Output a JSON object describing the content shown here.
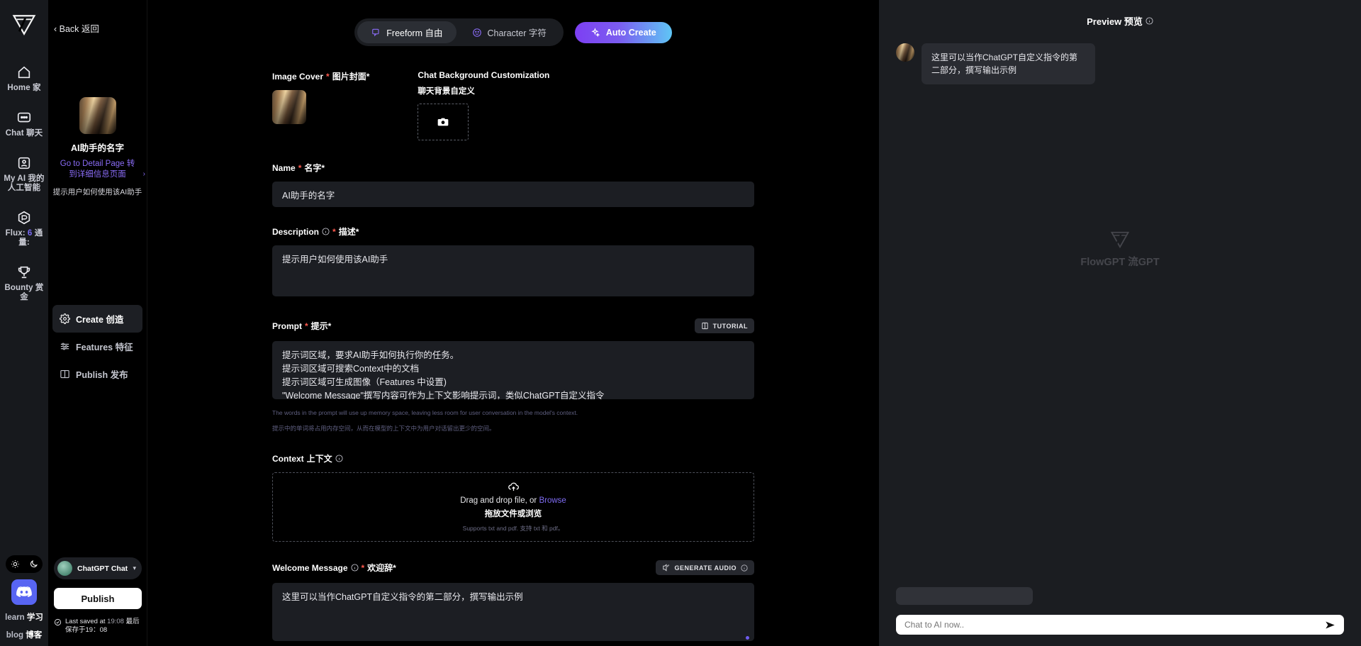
{
  "rail": {
    "logo_icon": "flowgpt-logo-icon",
    "items": [
      {
        "icon": "home-icon",
        "label": "Home 家"
      },
      {
        "icon": "chat-icon",
        "label": "Chat 聊天"
      },
      {
        "icon": "my-ai-icon",
        "label": "My AI 我的人工智能"
      },
      {
        "icon": "flux-icon",
        "label_pre": "Flux: ",
        "label_num": "6",
        "label_post": " 通量:"
      },
      {
        "icon": "trophy-icon",
        "label": "Bounty 赏金"
      }
    ],
    "theme": {
      "light_icon": "sun-icon",
      "dark_icon": "moon-icon"
    },
    "discord_icon": "discord-icon",
    "links": [
      {
        "en": "learn ",
        "zh": "学习"
      },
      {
        "en": "blog ",
        "zh": "博客"
      }
    ]
  },
  "side": {
    "back_label": "‹ Back 返回",
    "bot_name": "AI助手的名字",
    "detail_link": "Go to Detail Page 转到详细信息页面",
    "bot_desc": "提示用户如何使用该AI助手",
    "menu": [
      {
        "icon": "gear-icon",
        "label": "Create 创造",
        "active": true
      },
      {
        "icon": "sliders-icon",
        "label": "Features 特征",
        "active": false
      },
      {
        "icon": "book-icon",
        "label": "Publish 发布",
        "active": false
      }
    ],
    "account_name": "ChatGPT ChatGPT的",
    "publish_label": "Publish",
    "saved_prefix": "Last saved at ",
    "saved_time": "19:08",
    "saved_suffix": " 最后保存于19：08"
  },
  "main": {
    "tabs": [
      {
        "icon": "speech-bubble-icon",
        "label": "Freeform  自由",
        "active": true
      },
      {
        "icon": "smiley-icon",
        "label": "Character  字符",
        "active": false
      }
    ],
    "auto_create": {
      "icon": "sparkle-icon",
      "label": "Auto Create"
    },
    "image_cover": {
      "label_en": "Image Cover",
      "req": "*",
      "label_zh": " 图片封面*"
    },
    "chat_bg": {
      "label_en": "Chat Background Customization",
      "label_zh": "聊天背景自定义",
      "upload_icon": "camera-icon"
    },
    "name": {
      "label_en": "Name",
      "req": "*",
      "label_zh": " 名字*",
      "value": "AI助手的名字"
    },
    "description": {
      "label_en": "Description",
      "info_icon": "info-icon",
      "req": "*",
      "label_zh": " 描述*",
      "value": "提示用户如何使用该AI助手"
    },
    "prompt": {
      "label_en": "Prompt",
      "req": "*",
      "label_zh": " 提示*",
      "tutorial": {
        "icon": "book-small-icon",
        "label": "TUTORIAL"
      },
      "value": "提示词区域，要求AI助手如何执行你的任务。\n提示词区域可搜索Context中的文档\n提示词区域可生成图像（Features 中设置)\n\"Welcome Message\"撰写内容可作为上下文影响提示词，类似ChatGPT自定义指令",
      "help_en": "The words in the prompt will use up memory space, leaving less room for user conversation in the model's context.",
      "help_zh": "提示中的单词将占用内存空间，从而在模型的上下文中为用户对话留出更少的空间。"
    },
    "context": {
      "label_en": "Context",
      "label_zh": " 上下文",
      "info_icon": "info-icon",
      "upload_icon": "cloud-upload-icon",
      "drop_text": "Drag and drop file, or ",
      "browse_label": "Browse",
      "drop_text_zh": "拖放文件或浏览",
      "supports": "Supports txt and pdf. 支持 txt 和 pdf。"
    },
    "welcome": {
      "label_en": "Welcome Message",
      "info_icon": "info-icon",
      "req": "*",
      "label_zh": " 欢迎辞*",
      "generate_audio": {
        "icon": "audio-icon",
        "label": "GENERATE AUDIO",
        "info_icon": "info-icon"
      },
      "value": "这里可以当作ChatGPT自定义指令的第二部分，撰写输出示例"
    }
  },
  "preview": {
    "title": "Preview 预览",
    "info_icon": "info-icon",
    "message": "这里可以当作ChatGPT自定义指令的第二部分，撰写输出示例",
    "watermark": {
      "icon": "flowgpt-logo-icon",
      "text": "FlowGPT 流GPT"
    },
    "chat_placeholder": "Chat to AI now..",
    "send_icon": "send-icon"
  },
  "colors": {
    "accent_purple": "#7d3ff2",
    "accent_blue": "#5fc6f5",
    "required_red": "#ff5a4e",
    "panel_bg": "#1b1d21",
    "discord_blurple": "#5865f2"
  }
}
